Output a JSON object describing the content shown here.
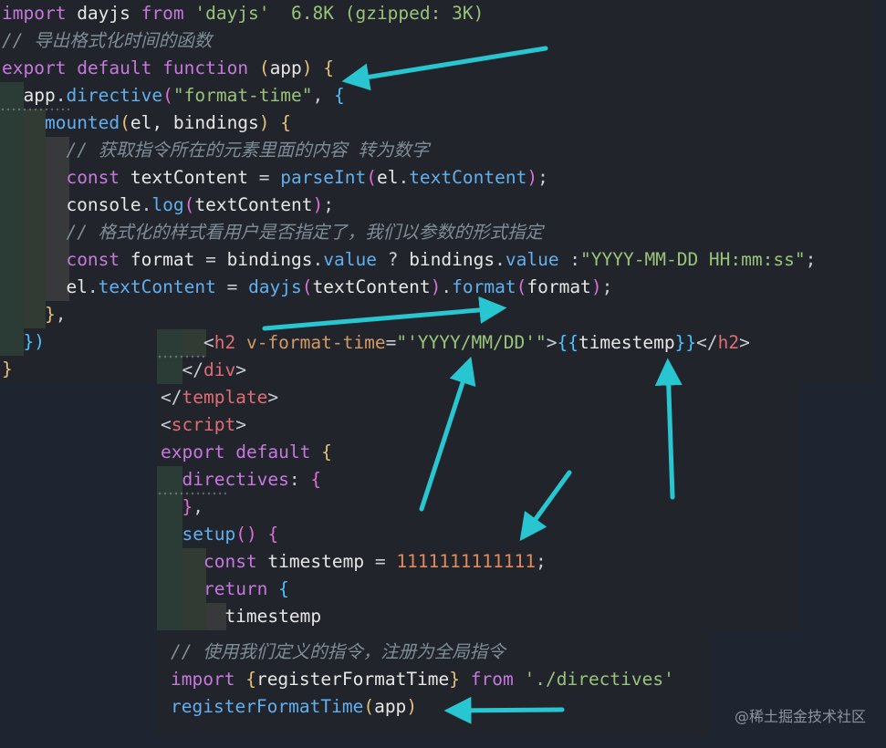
{
  "panel1": {
    "lines": [
      [
        {
          "t": "import",
          "c": "kw"
        },
        {
          "t": " dayjs ",
          "c": "id"
        },
        {
          "t": "from",
          "c": "kw"
        },
        {
          "t": " ",
          "c": "id"
        },
        {
          "t": "'dayjs'",
          "c": "str"
        },
        {
          "t": "  6.8K (gzipped: 3K)",
          "c": "str"
        }
      ],
      [
        {
          "t": "// 导出格式化时间的函数",
          "c": "cm"
        }
      ],
      [
        {
          "t": "export",
          "c": "kw"
        },
        {
          "t": " ",
          "c": "id"
        },
        {
          "t": "default",
          "c": "kw"
        },
        {
          "t": " ",
          "c": "id"
        },
        {
          "t": "function",
          "c": "kw"
        },
        {
          "t": " ",
          "c": "id"
        },
        {
          "t": "(",
          "c": "b1"
        },
        {
          "t": "app",
          "c": "id"
        },
        {
          "t": ")",
          "c": "b1"
        },
        {
          "t": " ",
          "c": "id"
        },
        {
          "t": "{",
          "c": "b1"
        }
      ],
      [
        {
          "t": "  app",
          "c": "id"
        },
        {
          "t": ".",
          "c": "pu"
        },
        {
          "t": "directive",
          "c": "fn"
        },
        {
          "t": "(",
          "c": "b2"
        },
        {
          "t": "\"format-time\"",
          "c": "str"
        },
        {
          "t": ", ",
          "c": "pu"
        },
        {
          "t": "{",
          "c": "b3"
        }
      ],
      [
        {
          "t": "    ",
          "c": "id"
        },
        {
          "t": "mounted",
          "c": "fn"
        },
        {
          "t": "(",
          "c": "b1"
        },
        {
          "t": "el, bindings",
          "c": "id"
        },
        {
          "t": ")",
          "c": "b1"
        },
        {
          "t": " ",
          "c": "id"
        },
        {
          "t": "{",
          "c": "b1"
        }
      ],
      [
        {
          "t": "      ",
          "c": "id"
        },
        {
          "t": "// 获取指令所在的元素里面的内容 转为数字",
          "c": "cm"
        }
      ],
      [
        {
          "t": "      ",
          "c": "id"
        },
        {
          "t": "const",
          "c": "kw"
        },
        {
          "t": " textContent ",
          "c": "id"
        },
        {
          "t": "=",
          "c": "pu"
        },
        {
          "t": " ",
          "c": "id"
        },
        {
          "t": "parseInt",
          "c": "fn"
        },
        {
          "t": "(",
          "c": "b2"
        },
        {
          "t": "el",
          "c": "id"
        },
        {
          "t": ".",
          "c": "pu"
        },
        {
          "t": "textContent",
          "c": "fn"
        },
        {
          "t": ")",
          "c": "b2"
        },
        {
          "t": ";",
          "c": "pu"
        }
      ],
      [
        {
          "t": "      console",
          "c": "id"
        },
        {
          "t": ".",
          "c": "pu"
        },
        {
          "t": "log",
          "c": "fn"
        },
        {
          "t": "(",
          "c": "b2"
        },
        {
          "t": "textContent",
          "c": "id"
        },
        {
          "t": ")",
          "c": "b2"
        },
        {
          "t": ";",
          "c": "pu"
        }
      ],
      [
        {
          "t": "      ",
          "c": "id"
        },
        {
          "t": "// 格式化的样式看用户是否指定了，我们以参数的形式指定",
          "c": "cm"
        }
      ],
      [
        {
          "t": "      ",
          "c": "id"
        },
        {
          "t": "const",
          "c": "kw"
        },
        {
          "t": " format ",
          "c": "id"
        },
        {
          "t": "=",
          "c": "pu"
        },
        {
          "t": " bindings",
          "c": "id"
        },
        {
          "t": ".",
          "c": "pu"
        },
        {
          "t": "value",
          "c": "fn"
        },
        {
          "t": " ? ",
          "c": "pu"
        },
        {
          "t": "bindings",
          "c": "id"
        },
        {
          "t": ".",
          "c": "pu"
        },
        {
          "t": "value",
          "c": "fn"
        },
        {
          "t": " :",
          "c": "pu"
        },
        {
          "t": "\"YYYY-MM-DD HH:mm:ss\"",
          "c": "str"
        },
        {
          "t": ";",
          "c": "pu"
        }
      ],
      [
        {
          "t": "      el",
          "c": "id"
        },
        {
          "t": ".",
          "c": "pu"
        },
        {
          "t": "textContent",
          "c": "fn"
        },
        {
          "t": " ",
          "c": "id"
        },
        {
          "t": "=",
          "c": "pu"
        },
        {
          "t": " ",
          "c": "id"
        },
        {
          "t": "dayjs",
          "c": "fn"
        },
        {
          "t": "(",
          "c": "b2"
        },
        {
          "t": "textContent",
          "c": "id"
        },
        {
          "t": ")",
          "c": "b2"
        },
        {
          "t": ".",
          "c": "pu"
        },
        {
          "t": "format",
          "c": "fn"
        },
        {
          "t": "(",
          "c": "b2"
        },
        {
          "t": "format",
          "c": "id"
        },
        {
          "t": ")",
          "c": "b2"
        },
        {
          "t": ";",
          "c": "pu"
        }
      ],
      [
        {
          "t": "    ",
          "c": "id"
        },
        {
          "t": "}",
          "c": "b1"
        },
        {
          "t": ",",
          "c": "pu"
        }
      ],
      [
        {
          "t": "  ",
          "c": "id"
        },
        {
          "t": "})",
          "c": "b3"
        }
      ],
      [
        {
          "t": "}",
          "c": "b1"
        }
      ]
    ]
  },
  "panel2": {
    "lines": [
      [
        {
          "t": "    ",
          "c": "id"
        },
        {
          "t": "<",
          "c": "pu"
        },
        {
          "t": "h2",
          "c": "tag"
        },
        {
          "t": " ",
          "c": "id"
        },
        {
          "t": "v-format-time",
          "c": "attr"
        },
        {
          "t": "=",
          "c": "pu"
        },
        {
          "t": "\"'YYYY/MM/DD'\"",
          "c": "str"
        },
        {
          "t": ">",
          "c": "pu"
        },
        {
          "t": "{{",
          "c": "b3"
        },
        {
          "t": "timestemp",
          "c": "id"
        },
        {
          "t": "}}",
          "c": "b3"
        },
        {
          "t": "</",
          "c": "pu"
        },
        {
          "t": "h2",
          "c": "tag"
        },
        {
          "t": ">",
          "c": "pu"
        }
      ],
      [
        {
          "t": "  ",
          "c": "id"
        },
        {
          "t": "</",
          "c": "pu"
        },
        {
          "t": "div",
          "c": "tag"
        },
        {
          "t": ">",
          "c": "pu"
        }
      ],
      [
        {
          "t": "</",
          "c": "pu"
        },
        {
          "t": "template",
          "c": "tag"
        },
        {
          "t": ">",
          "c": "pu"
        }
      ],
      [
        {
          "t": "<",
          "c": "pu"
        },
        {
          "t": "script",
          "c": "tag"
        },
        {
          "t": ">",
          "c": "pu"
        }
      ],
      [
        {
          "t": "export",
          "c": "kw"
        },
        {
          "t": " ",
          "c": "id"
        },
        {
          "t": "default",
          "c": "kw"
        },
        {
          "t": " ",
          "c": "id"
        },
        {
          "t": "{",
          "c": "b1"
        }
      ],
      [
        {
          "t": "  ",
          "c": "id"
        },
        {
          "t": "directives",
          "c": "kw"
        },
        {
          "t": ":",
          "c": "pu"
        },
        {
          "t": " ",
          "c": "id"
        },
        {
          "t": "{",
          "c": "b2"
        }
      ],
      [
        {
          "t": "  ",
          "c": "id"
        },
        {
          "t": "}",
          "c": "b2"
        },
        {
          "t": ",",
          "c": "pu"
        }
      ],
      [
        {
          "t": "  ",
          "c": "id"
        },
        {
          "t": "setup",
          "c": "fn"
        },
        {
          "t": "(",
          "c": "b2"
        },
        {
          "t": ")",
          "c": "b2"
        },
        {
          "t": " ",
          "c": "id"
        },
        {
          "t": "{",
          "c": "b2"
        }
      ],
      [
        {
          "t": "    ",
          "c": "id"
        },
        {
          "t": "const",
          "c": "kw"
        },
        {
          "t": " timestemp ",
          "c": "id"
        },
        {
          "t": "=",
          "c": "pu"
        },
        {
          "t": " ",
          "c": "id"
        },
        {
          "t": "1111111111111",
          "c": "num"
        },
        {
          "t": ";",
          "c": "pu"
        }
      ],
      [
        {
          "t": "    ",
          "c": "id"
        },
        {
          "t": "return",
          "c": "kw"
        },
        {
          "t": " ",
          "c": "id"
        },
        {
          "t": "{",
          "c": "b3"
        }
      ],
      [
        {
          "t": "      timestemp",
          "c": "id"
        }
      ]
    ]
  },
  "panel3": {
    "lines": [
      [
        {
          "t": "// 使用我们定义的指令，注册为全局指令",
          "c": "cm"
        }
      ],
      [
        {
          "t": "import",
          "c": "kw"
        },
        {
          "t": " ",
          "c": "id"
        },
        {
          "t": "{",
          "c": "b1"
        },
        {
          "t": "registerFormatTime",
          "c": "id"
        },
        {
          "t": "}",
          "c": "b1"
        },
        {
          "t": " ",
          "c": "id"
        },
        {
          "t": "from",
          "c": "kw"
        },
        {
          "t": " ",
          "c": "id"
        },
        {
          "t": "'./directives'",
          "c": "str"
        }
      ],
      [
        {
          "t": "registerFormatTime",
          "c": "fn"
        },
        {
          "t": "(",
          "c": "b1"
        },
        {
          "t": "app",
          "c": "id"
        },
        {
          "t": ")",
          "c": "b1"
        }
      ]
    ]
  },
  "watermark": "@稀土掘金技术社区",
  "colors": {
    "arrow": "#27c6d0",
    "background": "#1e2531",
    "panel": "#21252b"
  }
}
